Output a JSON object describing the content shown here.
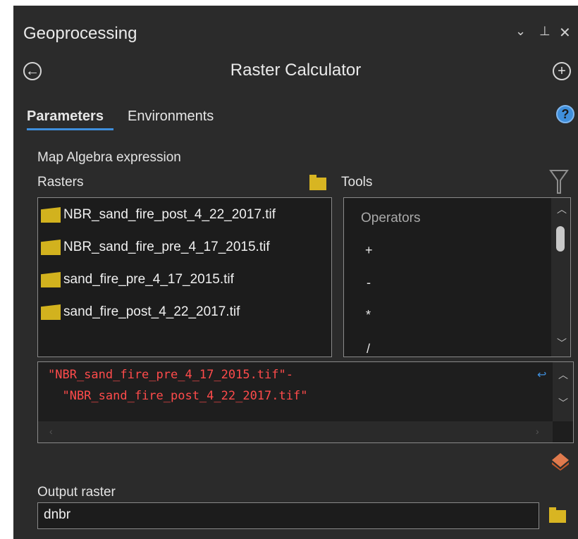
{
  "window": {
    "title": "Geoprocessing",
    "icons": {
      "menu": "chevron-down-icon",
      "pin": "pin-icon",
      "close": "close-icon"
    }
  },
  "tool": {
    "title": "Raster Calculator"
  },
  "tabs": [
    {
      "label": "Parameters",
      "active": true
    },
    {
      "label": "Environments",
      "active": false
    }
  ],
  "help_glyph": "?",
  "expression_section": {
    "label": "Map Algebra expression",
    "rasters_label": "Rasters",
    "tools_label": "Tools",
    "rasters": [
      "NBR_sand_fire_post_4_22_2017.tif",
      "NBR_sand_fire_pre_4_17_2015.tif",
      "sand_fire_pre_4_17_2015.tif",
      "sand_fire_post_4_22_2017.tif"
    ],
    "tools_header": "Operators",
    "operators": [
      "+",
      "-",
      "*",
      "/"
    ],
    "expression_lines": [
      "\"NBR_sand_fire_pre_4_17_2015.tif\"-",
      "  \"NBR_sand_fire_post_4_22_2017.tif\""
    ]
  },
  "output": {
    "label": "Output raster",
    "value": "dnbr"
  },
  "colors": {
    "panel_bg": "#2b2b2b",
    "field_bg": "#1c1c1c",
    "accent": "#3f8fdc",
    "expression_text": "#ff4b4b",
    "folder": "#d8b522"
  }
}
